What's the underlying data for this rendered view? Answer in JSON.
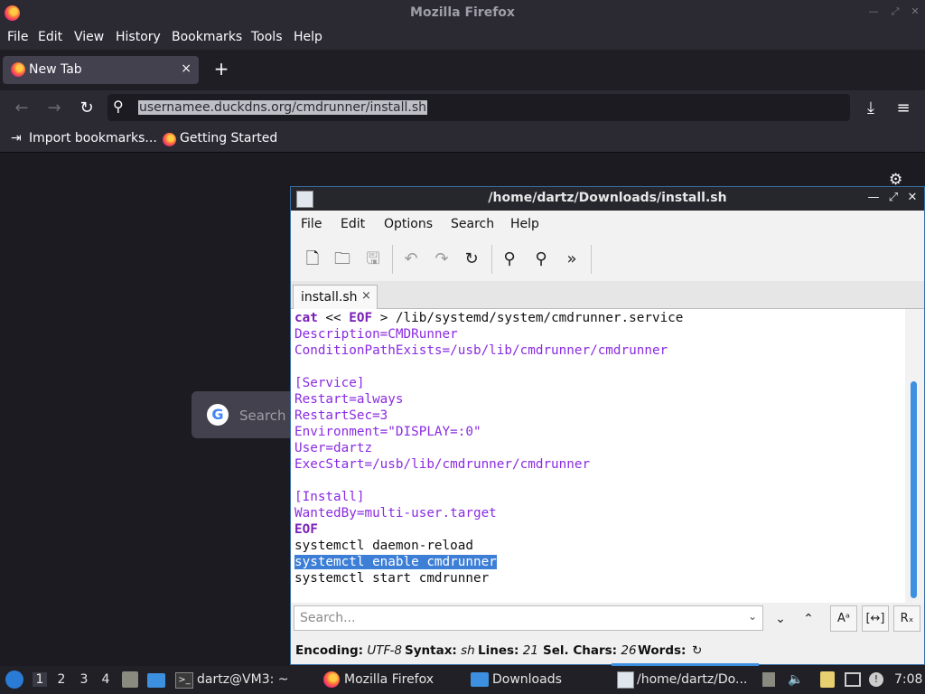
{
  "firefox": {
    "window_title": "Mozilla Firefox",
    "menu": [
      "File",
      "Edit",
      "View",
      "History",
      "Bookmarks",
      "Tools",
      "Help"
    ],
    "tab_label": "New Tab",
    "tab_close": "×",
    "new_tab": "+",
    "url": "usernamee.duckdns.org/cmdrunner/install.sh",
    "bookmarks": [
      "Import bookmarks...",
      "Getting Started"
    ],
    "search_placeholder": "Search w"
  },
  "editor": {
    "window_title": "/home/dartz/Downloads/install.sh",
    "menu": [
      "File",
      "Edit",
      "Options",
      "Search",
      "Help"
    ],
    "tab_label": "install.sh",
    "tab_close": "×",
    "lines": [
      "cat << EOF > /lib/systemd/system/cmdrunner.service",
      "Description=CMDRunner",
      "ConditionPathExists=/usb/lib/cmdrunner/cmdrunner",
      "",
      "[Service]",
      "Restart=always",
      "RestartSec=3",
      "Environment=\"DISPLAY=:0\"",
      "User=dartz",
      "ExecStart=/usb/lib/cmdrunner/cmdrunner",
      "",
      "[Install]",
      "WantedBy=multi-user.target",
      "EOF",
      "systemctl daemon-reload",
      "systemctl enable cmdrunner",
      "systemctl start cmdrunner"
    ],
    "selected_line": "systemctl enable cmdrunner",
    "search_placeholder": "Search...",
    "status": {
      "encoding_label": "Encoding:",
      "encoding": "UTF-8",
      "syntax_label": "Syntax:",
      "syntax": "sh",
      "lines_label": "Lines:",
      "lines": "21",
      "selchars_label": "Sel. Chars:",
      "selchars": "26",
      "words_label": "Words:"
    }
  },
  "taskbar": {
    "workspaces": [
      "1",
      "2",
      "3",
      "4"
    ],
    "items": [
      "dartz@VM3: ~",
      "Mozilla Firefox",
      "Downloads",
      "/home/dartz/Do..."
    ],
    "clock": "7:08"
  }
}
